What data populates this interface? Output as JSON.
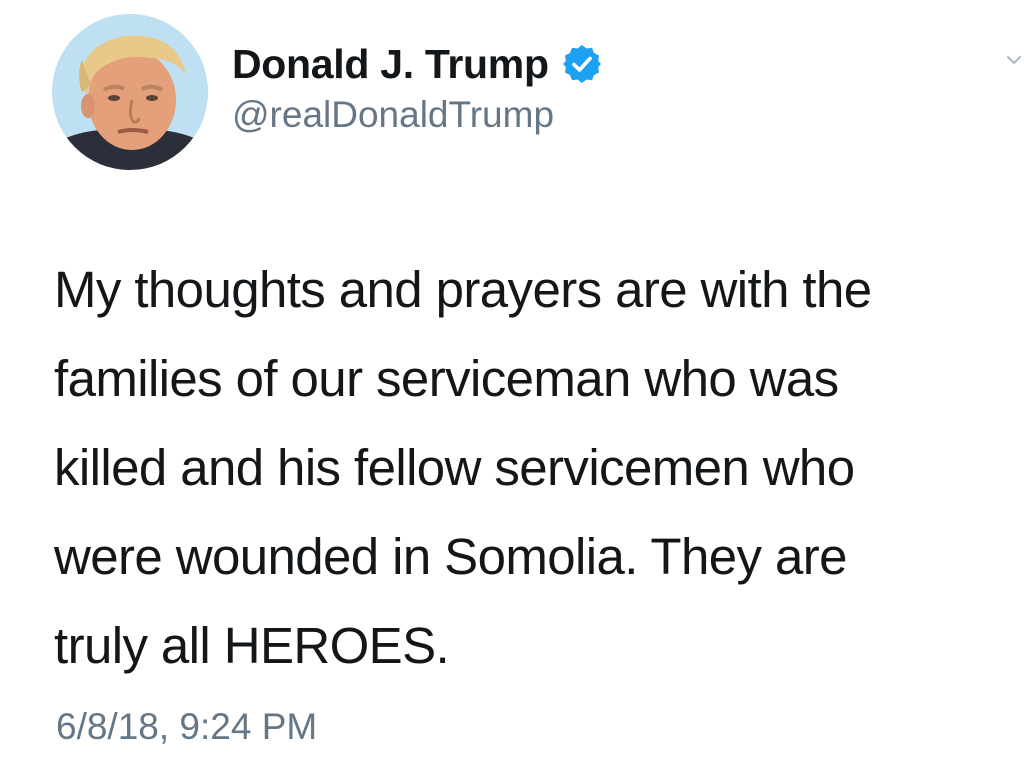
{
  "tweet": {
    "author": {
      "display_name": "Donald J. Trump",
      "handle": "@realDonaldTrump",
      "verified": true,
      "avatar_icon": "profile-photo",
      "verified_icon": "verified-badge-icon"
    },
    "text": "My thoughts and prayers are with the\nfamilies of our serviceman who was\nkilled and his fellow servicemen who\nwere wounded in Somolia. They are\ntruly all HEROES.",
    "timestamp": "6/8/18, 9:24 PM",
    "menu_icon": "chevron-down-icon"
  },
  "colors": {
    "text": "#14171a",
    "secondary": "#657786",
    "verified": "#1da1f2",
    "background": "#ffffff"
  }
}
